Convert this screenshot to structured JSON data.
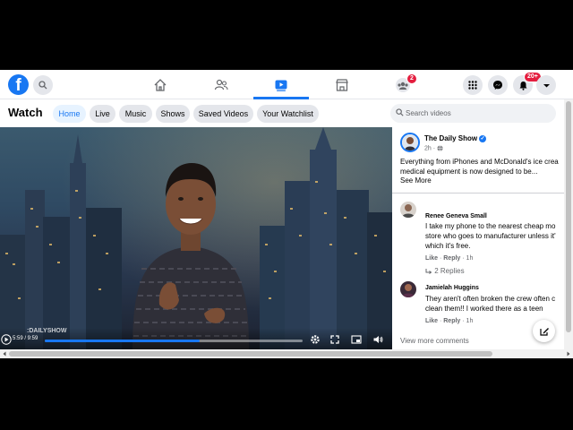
{
  "nav": {
    "logo_letter": "f",
    "notifications_badge": "2",
    "alerts_badge": "20+",
    "icons": [
      "home-icon",
      "friends-icon",
      "watch-icon",
      "marketplace-icon",
      "groups-icon",
      "menu-grid-icon",
      "messenger-icon",
      "bell-icon",
      "account-caret-icon"
    ]
  },
  "watch": {
    "title": "Watch",
    "tabs": [
      {
        "label": "Home",
        "active": true
      },
      {
        "label": "Live"
      },
      {
        "label": "Music"
      },
      {
        "label": "Shows"
      },
      {
        "label": "Saved Videos"
      },
      {
        "label": "Your Watchlist"
      }
    ],
    "search_placeholder": "Search videos"
  },
  "video": {
    "time": "5:59 / 9:59",
    "progress": 0.6,
    "watermark": ":DAILYSHOW"
  },
  "post": {
    "page_name": "The Daily Show",
    "verified_mark": "✓",
    "time": "2h ·",
    "text": "Everything from iPhones and McDonald's ice crea",
    "text_line2": "medical equipment is now designed to be...",
    "see_more": "See More"
  },
  "comments": [
    {
      "name": "Renee Geneva Small",
      "line1": "I take my phone to the nearest cheap mo",
      "line2": "store who goes to manufacturer unless it'",
      "line3": "which it's free.",
      "like": "Like",
      "reply": "Reply",
      "time": "1h",
      "replies": "2 Replies"
    },
    {
      "name": "Jamielah Huggins",
      "line1": "They aren't often broken the crew often c",
      "line2": "clean them!! I worked there as a teen",
      "like": "Like",
      "reply": "Reply",
      "time": "1h"
    }
  ],
  "view_more": "View more comments",
  "colors": {
    "brand": "#1877f2",
    "badge": "#e41e3f"
  }
}
